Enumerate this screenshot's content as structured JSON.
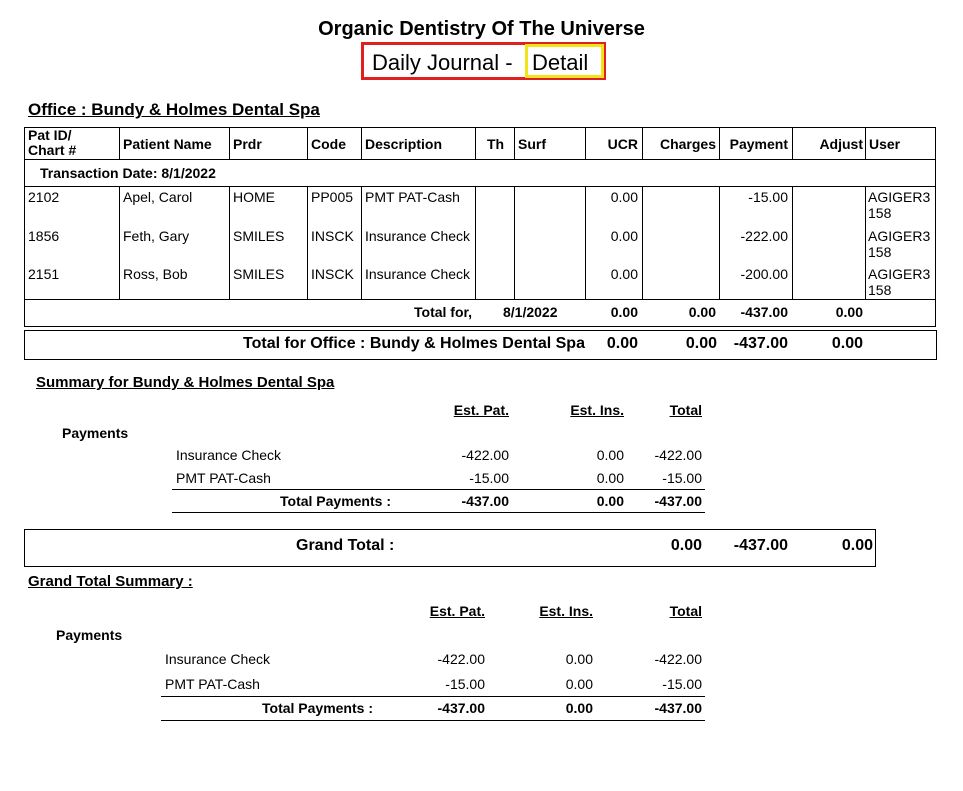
{
  "header": {
    "practice_name": "Organic Dentistry Of The Universe",
    "report_title_part1": "Daily Journal -",
    "report_title_part2": "Detail"
  },
  "office_heading": "Office : Bundy & Holmes Dental Spa",
  "table": {
    "columns": {
      "pat_id_line1": "Pat ID/",
      "pat_id_line2": "Chart #",
      "patient_name": "Patient Name",
      "prdr": "Prdr",
      "code": "Code",
      "description": "Description",
      "th": "Th",
      "surf": "Surf",
      "ucr": "UCR",
      "charges": "Charges",
      "payment": "Payment",
      "adjust": "Adjust",
      "user": "User"
    },
    "transaction_date": "Transaction Date: 8/1/2022",
    "rows": [
      {
        "pat_id": "2102",
        "name": "Apel, Carol",
        "prdr": "HOME",
        "code": "PP005",
        "desc": "PMT PAT-Cash",
        "ucr": "0.00",
        "payment": "-15.00",
        "user1": "AGIGER3",
        "user2": "158"
      },
      {
        "pat_id": "1856",
        "name": "Feth, Gary",
        "prdr": "SMILES",
        "code": "INSCK",
        "desc": "Insurance Check",
        "ucr": "0.00",
        "payment": "-222.00",
        "user1": "AGIGER3",
        "user2": "158"
      },
      {
        "pat_id": "2151",
        "name": "Ross, Bob",
        "prdr": "SMILES",
        "code": "INSCK",
        "desc": "Insurance Check",
        "ucr": "0.00",
        "payment": "-200.00",
        "user1": "AGIGER3",
        "user2": "158"
      }
    ],
    "total_for_label": "Total for,",
    "total_for_date": "8/1/2022",
    "total_ucr": "0.00",
    "total_charges": "0.00",
    "total_payment": "-437.00",
    "total_adjust": "0.00"
  },
  "office_total": {
    "label": "Total for Office : Bundy & Holmes Dental Spa",
    "ucr": "0.00",
    "charges": "0.00",
    "payment": "-437.00",
    "adjust": "0.00"
  },
  "summary": {
    "heading": "Summary for Bundy & Holmes Dental Spa",
    "col_est_pat": "Est. Pat.",
    "col_est_ins": "Est. Ins.",
    "col_total": "Total",
    "section_label": "Payments",
    "rows": [
      {
        "label": "Insurance Check",
        "est_pat": "-422.00",
        "est_ins": "0.00",
        "total": "-422.00"
      },
      {
        "label": "PMT PAT-Cash",
        "est_pat": "-15.00",
        "est_ins": "0.00",
        "total": "-15.00"
      }
    ],
    "total_label": "Total Payments :",
    "total_est_pat": "-437.00",
    "total_est_ins": "0.00",
    "total_total": "-437.00"
  },
  "grand_total": {
    "label": "Grand Total :",
    "charges": "0.00",
    "payment": "-437.00",
    "adjust": "0.00"
  },
  "grand_summary": {
    "heading": "Grand Total Summary :",
    "col_est_pat": "Est. Pat.",
    "col_est_ins": "Est. Ins.",
    "col_total": "Total",
    "section_label": "Payments",
    "rows": [
      {
        "label": "Insurance Check",
        "est_pat": "-422.00",
        "est_ins": "0.00",
        "total": "-422.00"
      },
      {
        "label": "PMT PAT-Cash",
        "est_pat": "-15.00",
        "est_ins": "0.00",
        "total": "-15.00"
      }
    ],
    "total_label": "Total Payments :",
    "total_est_pat": "-437.00",
    "total_est_ins": "0.00",
    "total_total": "-437.00"
  },
  "colors": {
    "highlight_red": "#e0201e",
    "highlight_yellow": "#f2e418"
  }
}
